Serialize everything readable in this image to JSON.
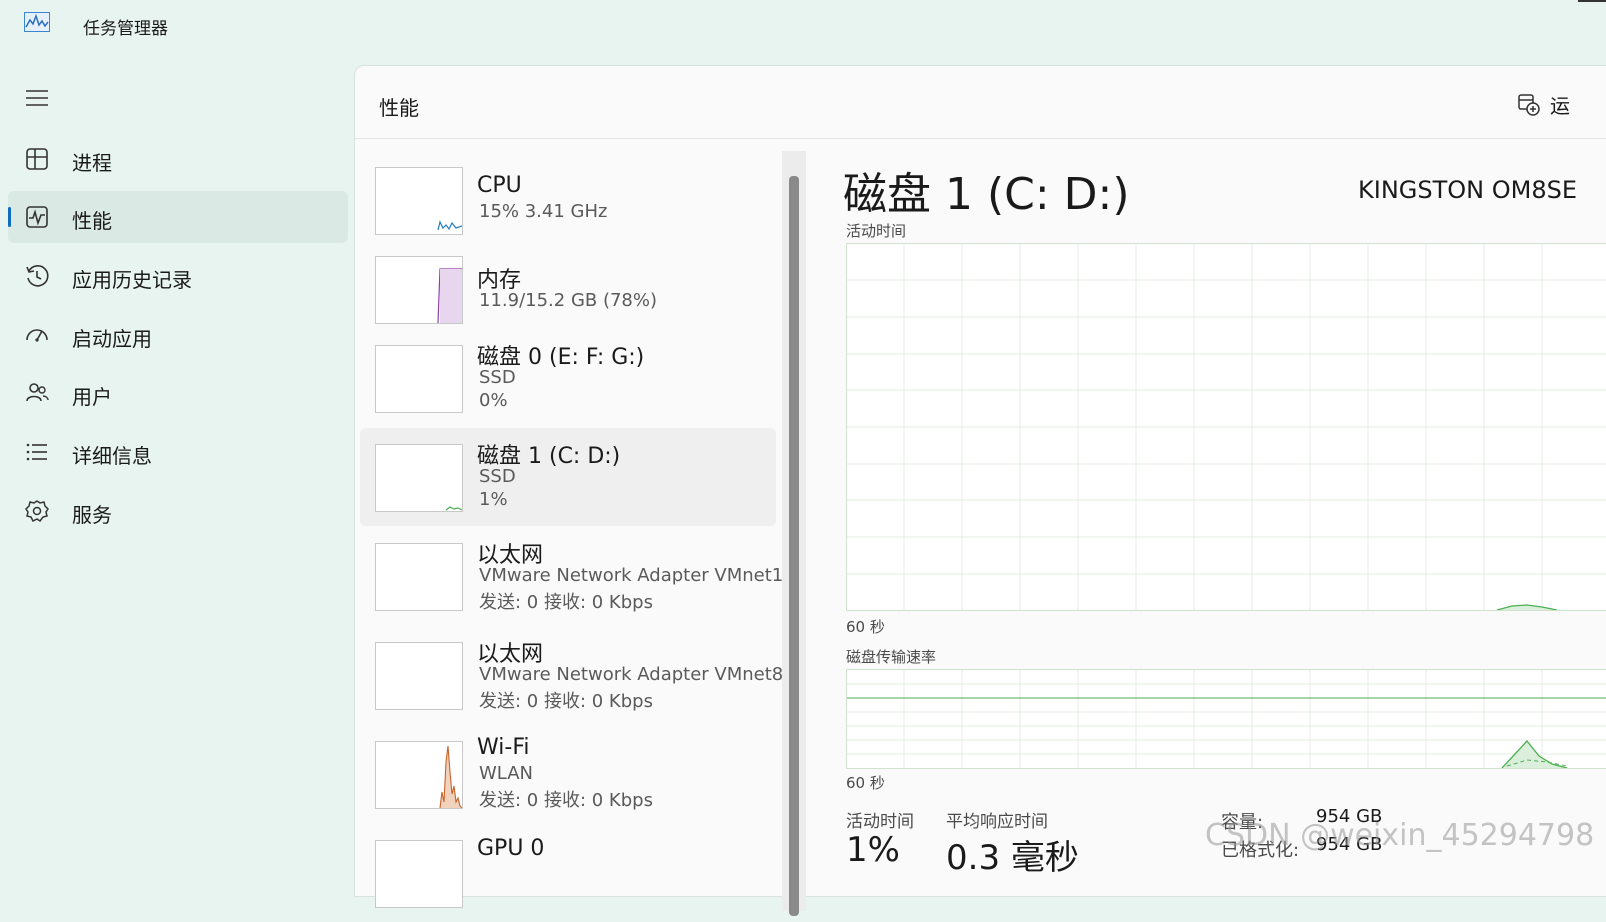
{
  "window": {
    "title": "任务管理器",
    "icon": "task-manager-icon"
  },
  "nav": {
    "menu_icon": "hamburger-icon",
    "items": [
      {
        "label": "进程",
        "icon": "processes-icon",
        "active": false
      },
      {
        "label": "性能",
        "icon": "performance-icon",
        "active": true
      },
      {
        "label": "应用历史记录",
        "icon": "history-icon",
        "active": false
      },
      {
        "label": "启动应用",
        "icon": "startup-icon",
        "active": false
      },
      {
        "label": "用户",
        "icon": "users-icon",
        "active": false
      },
      {
        "label": "详细信息",
        "icon": "details-icon",
        "active": false
      },
      {
        "label": "服务",
        "icon": "services-icon",
        "active": false
      }
    ]
  },
  "header": {
    "title": "性能",
    "run_task_label": "运",
    "run_task_icon": "run-new-task-icon"
  },
  "resources": [
    {
      "name": "CPU",
      "line1": "15%  3.41 GHz",
      "line2": "",
      "color": "#1f7fc4"
    },
    {
      "name": "内存",
      "line1": "11.9/15.2 GB (78%)",
      "line2": "",
      "color": "#8e3fa6"
    },
    {
      "name": "磁盘 0 (E: F: G:)",
      "line1": "SSD",
      "line2": "0%",
      "color": "#4caf50"
    },
    {
      "name": "磁盘 1 (C: D:)",
      "line1": "SSD",
      "line2": "1%",
      "color": "#4caf50"
    },
    {
      "name": "以太网",
      "line1": "VMware Network Adapter VMnet1",
      "line2": "发送: 0  接收: 0 Kbps",
      "color": "#a25c24"
    },
    {
      "name": "以太网",
      "line1": "VMware Network Adapter VMnet8",
      "line2": "发送: 0  接收: 0 Kbps",
      "color": "#a25c24"
    },
    {
      "name": "Wi-Fi",
      "line1": "WLAN",
      "line2": "发送: 0  接收: 0 Kbps",
      "color": "#c8642a"
    },
    {
      "name": "GPU 0",
      "line1": "",
      "line2": "",
      "color": "#1f7fc4"
    }
  ],
  "detail": {
    "title": "磁盘 1 (C: D:)",
    "model": "KINGSTON OM8SE",
    "activity_label": "活动时间",
    "activity_time_axis": "60 秒",
    "transfer_label": "磁盘传输速率",
    "transfer_time_axis": "60 秒",
    "stats": [
      {
        "label": "活动时间",
        "value": "1%"
      },
      {
        "label": "平均响应时间",
        "value": "0.3 毫秒"
      }
    ],
    "info": [
      {
        "label": "容量:",
        "value": "954 GB"
      },
      {
        "label": "已格式化:",
        "value": "954 GB"
      }
    ],
    "graph_color": "#4caf50"
  },
  "watermark": "CSDN @weixin_45294798"
}
